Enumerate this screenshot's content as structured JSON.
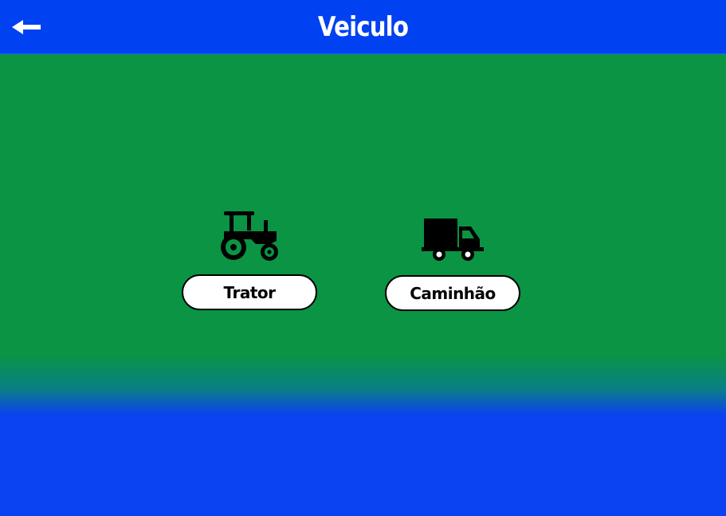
{
  "header": {
    "title": "Veiculo",
    "back_icon": "arrow-left-icon"
  },
  "options": [
    {
      "label": "Trator",
      "icon": "tractor-icon"
    },
    {
      "label": "Caminhão",
      "icon": "truck-icon"
    }
  ],
  "colors": {
    "header_bg": "#0041f2",
    "main_bg": "#0a9444",
    "bottom_bg": "#0a41f0",
    "button_bg": "#ffffff",
    "text_dark": "#000000",
    "title_text": "#ffffff"
  }
}
